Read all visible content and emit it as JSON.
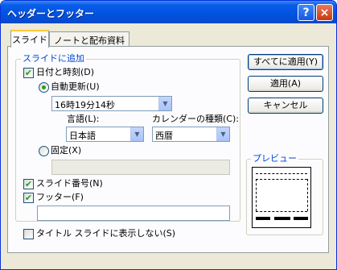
{
  "window": {
    "title": "ヘッダーとフッター",
    "help_glyph": "?",
    "close_glyph": "×"
  },
  "tabs": [
    {
      "label": "スライド",
      "active": true
    },
    {
      "label": "ノートと配布資料",
      "active": false
    }
  ],
  "include_group": {
    "label": "スライドに追加",
    "date_time": {
      "label": "日付と時刻(D)",
      "checked": true,
      "auto_update": {
        "label": "自動更新(U)",
        "selected": true,
        "value": "16時19分14秒"
      },
      "language": {
        "label": "言語(L):",
        "value": "日本語"
      },
      "calendar": {
        "label": "カレンダーの種類(C):",
        "value": "西暦"
      },
      "fixed": {
        "label": "固定(X)",
        "selected": false,
        "value": ""
      }
    },
    "slide_number": {
      "label": "スライド番号(N)",
      "checked": true
    },
    "footer": {
      "label": "フッター(F)",
      "checked": true,
      "value": ""
    }
  },
  "dont_show_title": {
    "label": "タイトル スライドに表示しない(S)",
    "checked": false
  },
  "buttons": {
    "apply_all": "すべてに適用(Y)",
    "apply": "適用(A)",
    "cancel": "キャンセル"
  },
  "preview": {
    "label": "プレビュー"
  },
  "colors": {
    "titlebar": "#0052e0",
    "accent": "#0046d5",
    "check": "#21a121"
  }
}
